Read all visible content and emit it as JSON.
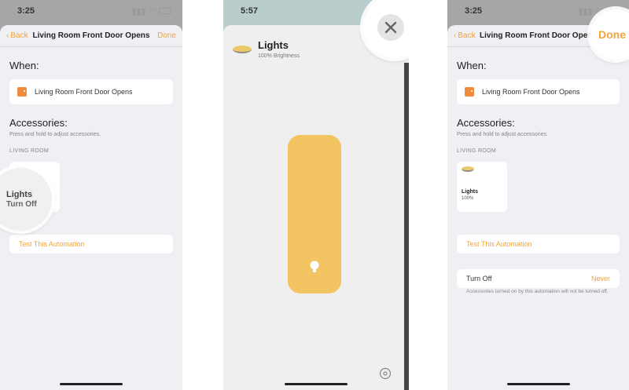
{
  "panel_left": {
    "status_time": "3:25",
    "nav": {
      "back": "Back",
      "title": "Living Room Front Door Opens",
      "done": "Done"
    },
    "when_title": "When:",
    "trigger_label": "Living Room Front Door Opens",
    "accessories_title": "Accessories:",
    "accessories_hint": "Press and hold to adjust accessories.",
    "room": "LIVING ROOM",
    "tile": {
      "name": "Lights",
      "state": "Turn Off"
    },
    "test_button": "Test This Automation"
  },
  "panel_middle": {
    "status_time": "5:57",
    "title": "Lights",
    "subtitle": "100% Brightness",
    "brightness": 1.0
  },
  "panel_right": {
    "status_time": "3:25",
    "nav": {
      "back": "Back",
      "title": "Living Room Front Door Opens",
      "done": "Done"
    },
    "when_title": "When:",
    "trigger_label": "Living Room Front Door Opens",
    "accessories_title": "Accessories:",
    "accessories_hint": "Press and hold to adjust accessories.",
    "room": "LIVING ROOM",
    "tile": {
      "name": "Lights",
      "state": "100%"
    },
    "test_button": "Test This Automation",
    "turn_off_label": "Turn Off",
    "turn_off_value": "Never",
    "footnote": "Accessories turned on by this automation will not be turned off."
  },
  "colors": {
    "accent": "#f2a33a",
    "light_yellow": "#f3c562",
    "background_gray": "#a6a6a6"
  }
}
